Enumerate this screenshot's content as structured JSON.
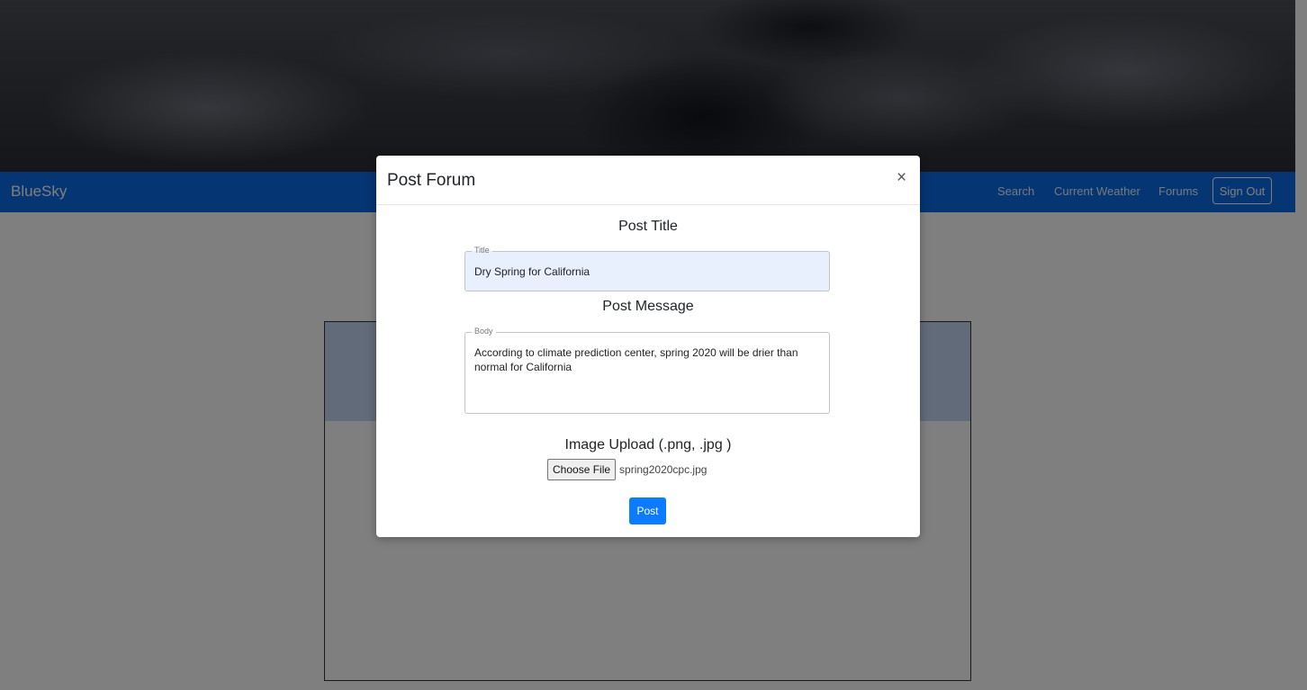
{
  "navbar": {
    "brand": "BlueSky",
    "links": [
      "Search",
      "Current Weather",
      "Forums"
    ],
    "signout_label": "Sign Out"
  },
  "modal": {
    "title": "Post Forum",
    "close_symbol": "×",
    "post_title_label": "Post Title",
    "title_legend": "Title",
    "title_value": "Dry Spring for California",
    "post_message_label": "Post Message",
    "body_legend": "Body",
    "body_value": "According to climate prediction center, spring 2020 will be drier than normal for California",
    "image_upload_label": "Image Upload (.png, .jpg )",
    "choose_file_label": "Choose File",
    "selected_file": "spring2020cpc.jpg",
    "post_label": "Post"
  }
}
